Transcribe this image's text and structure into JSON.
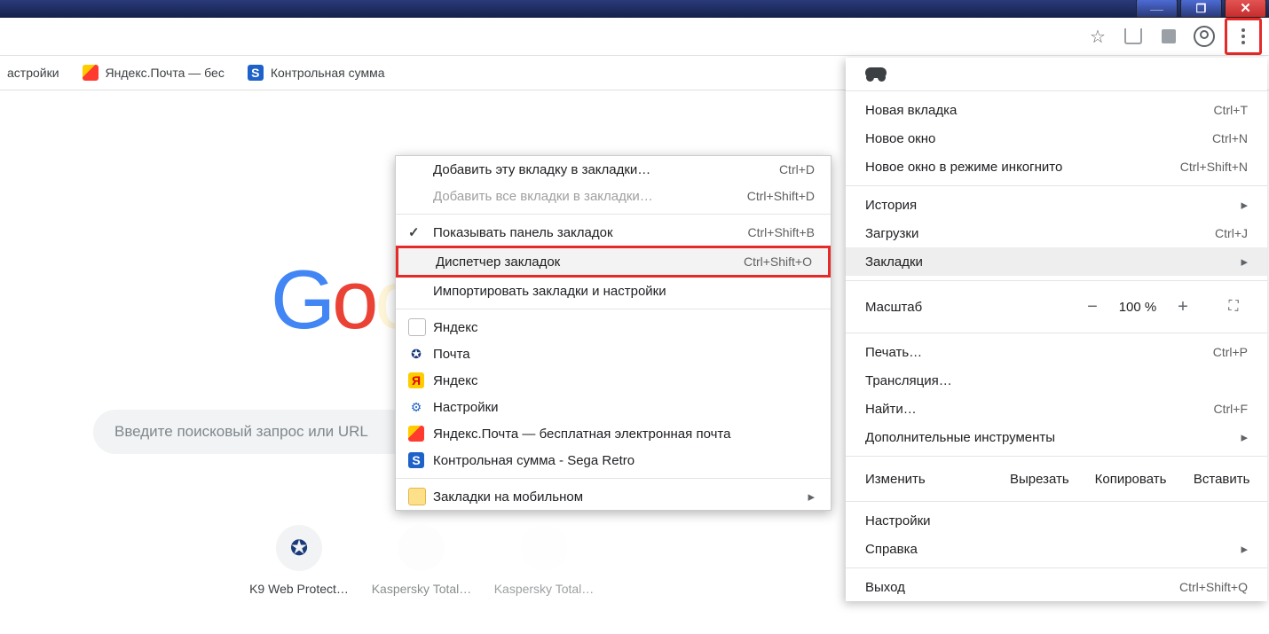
{
  "bookmarksBar": {
    "items": [
      {
        "label": "астройки"
      },
      {
        "label": "Яндекс.Почта — бес"
      },
      {
        "label": "Контрольная сумма"
      }
    ]
  },
  "page": {
    "searchPlaceholder": "Введите поисковый запрос или URL",
    "shortcuts": [
      {
        "label": "K9 Web Protect…"
      },
      {
        "label": "Kaspersky Total…"
      },
      {
        "label": "Kaspersky Total…"
      }
    ]
  },
  "mainMenu": {
    "newTab": {
      "label": "Новая вкладка",
      "key": "Ctrl+T"
    },
    "newWindow": {
      "label": "Новое окно",
      "key": "Ctrl+N"
    },
    "newIncognito": {
      "label": "Новое окно в режиме инкогнито",
      "key": "Ctrl+Shift+N"
    },
    "history": {
      "label": "История"
    },
    "downloads": {
      "label": "Загрузки",
      "key": "Ctrl+J"
    },
    "bookmarks": {
      "label": "Закладки"
    },
    "zoom": {
      "label": "Масштаб",
      "value": "100 %"
    },
    "print": {
      "label": "Печать…",
      "key": "Ctrl+P"
    },
    "cast": {
      "label": "Трансляция…"
    },
    "find": {
      "label": "Найти…",
      "key": "Ctrl+F"
    },
    "moreTools": {
      "label": "Дополнительные инструменты"
    },
    "edit": {
      "label": "Изменить",
      "cut": "Вырезать",
      "copy": "Копировать",
      "paste": "Вставить"
    },
    "settings": {
      "label": "Настройки"
    },
    "help": {
      "label": "Справка"
    },
    "exit": {
      "label": "Выход",
      "key": "Ctrl+Shift+Q"
    }
  },
  "subMenu": {
    "addTab": {
      "label": "Добавить эту вкладку в закладки…",
      "key": "Ctrl+D"
    },
    "addAll": {
      "label": "Добавить все вкладки в закладки…",
      "key": "Ctrl+Shift+D"
    },
    "showBar": {
      "label": "Показывать панель закладок",
      "key": "Ctrl+Shift+B"
    },
    "manager": {
      "label": "Диспетчер закладок",
      "key": "Ctrl+Shift+O"
    },
    "import": {
      "label": "Импортировать закладки и настройки"
    },
    "bm": [
      {
        "label": "Яндекс"
      },
      {
        "label": "Почта"
      },
      {
        "label": "Яндекс"
      },
      {
        "label": "Настройки"
      },
      {
        "label": "Яндекс.Почта — бесплатная электронная почта"
      },
      {
        "label": "Контрольная сумма - Sega Retro"
      }
    ],
    "mobile": {
      "label": "Закладки на мобильном"
    }
  }
}
